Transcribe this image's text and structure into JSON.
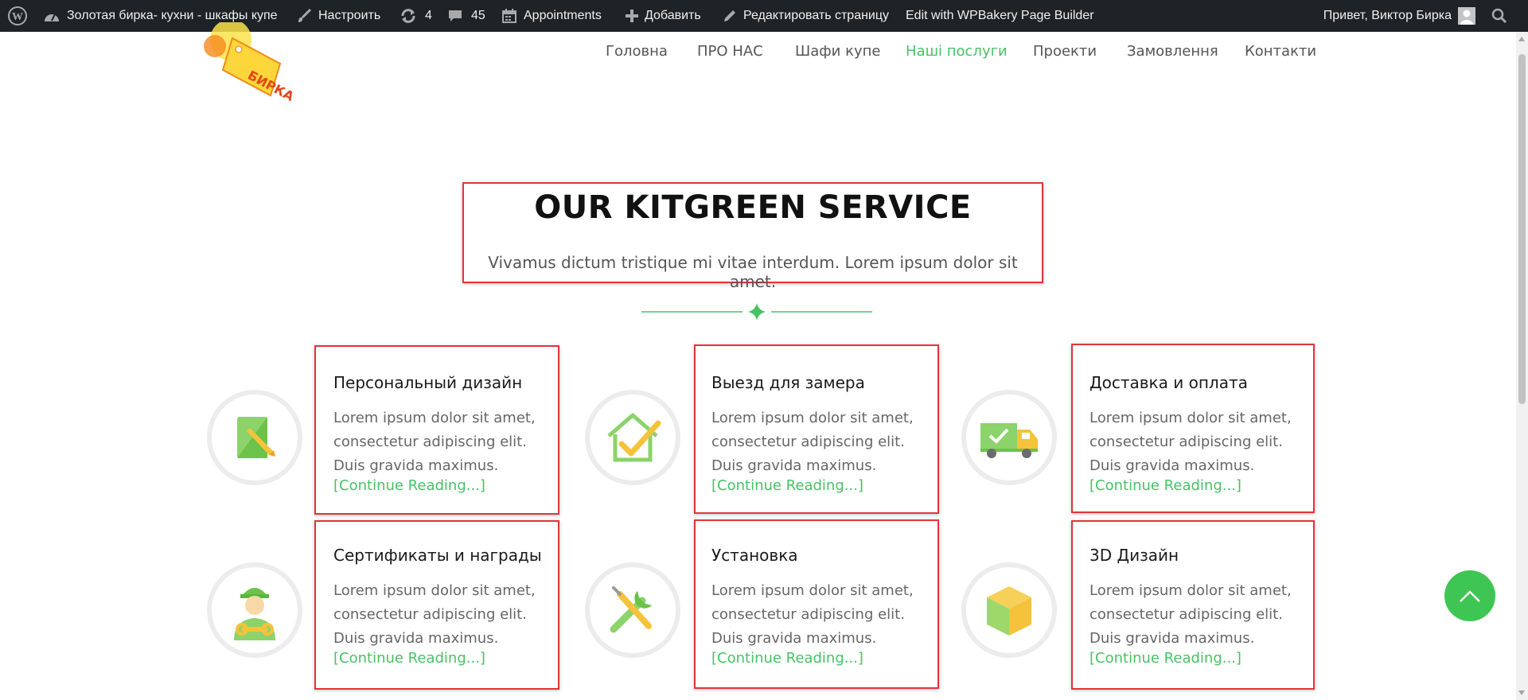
{
  "adminbar": {
    "site_name": "Золотая бирка- кухни - шкафы купе",
    "customize": "Настроить",
    "updates_count": "4",
    "comments_count": "45",
    "appointments": "Appointments",
    "add_new": "Добавить",
    "edit_page": "Редактировать страницу",
    "wpbakery": "Edit with WPBakery Page Builder",
    "greeting": "Привет, Виктор Бирка"
  },
  "logo": {
    "text": "БИРКА"
  },
  "nav": {
    "items": [
      "Головна",
      "ПРО НАС",
      "Шафи купе",
      "Наші послуги",
      "Проекти",
      "Замовлення",
      "Контакти"
    ],
    "active": "Наші послуги"
  },
  "section": {
    "title": "OUR KITGREEN SERVICE",
    "subtitle": "Vivamus dictum tristique mi vitae interdum. Lorem ipsum dolor sit amet."
  },
  "services": [
    {
      "title": "Персональный дизайн",
      "text": "Lorem ipsum dolor sit amet, consectetur adipiscing elit. Duis gravida maximus.",
      "link": "[Continue Reading...]",
      "icon": "design-tablet-icon"
    },
    {
      "title": "Выезд для замера",
      "text": "Lorem ipsum dolor sit amet, consectetur adipiscing elit. Duis gravida maximus.",
      "link": "[Continue Reading...]",
      "icon": "house-check-icon"
    },
    {
      "title": "Доставка и оплата",
      "text": "Lorem ipsum dolor sit amet, consectetur adipiscing elit. Duis gravida maximus.",
      "link": "[Continue Reading...]",
      "icon": "delivery-truck-icon"
    },
    {
      "title": "Сертификаты и награды",
      "text": "Lorem ipsum dolor sit amet, consectetur adipiscing elit. Duis gravida maximus.",
      "link": "[Continue Reading...]",
      "icon": "worker-icon"
    },
    {
      "title": "Установка",
      "text": "Lorem ipsum dolor sit amet, consectetur adipiscing elit. Duis gravida maximus.",
      "link": "[Continue Reading...]",
      "icon": "tools-icon"
    },
    {
      "title": "3D Дизайн",
      "text": "Lorem ipsum dolor sit amet, consectetur adipiscing elit. Duis gravida maximus.",
      "link": "[Continue Reading...]",
      "icon": "cube-3d-icon"
    }
  ],
  "colors": {
    "accent": "#47c265",
    "highlight": "#e3343b",
    "adminbar": "#1d2327"
  }
}
